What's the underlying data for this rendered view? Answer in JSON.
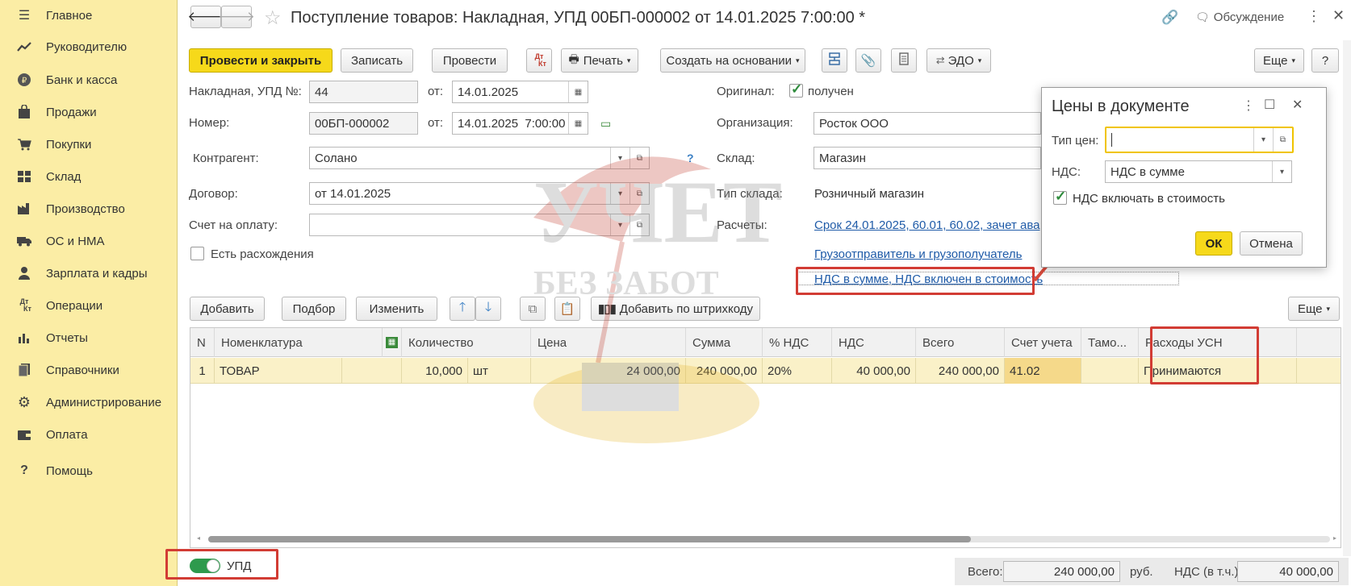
{
  "sidebar": {
    "items": [
      {
        "label": "Главное",
        "icon": "menu-icon"
      },
      {
        "label": "Руководителю",
        "icon": "trend-icon"
      },
      {
        "label": "Банк и касса",
        "icon": "coin-icon"
      },
      {
        "label": "Продажи",
        "icon": "bag-icon"
      },
      {
        "label": "Покупки",
        "icon": "cart-icon"
      },
      {
        "label": "Склад",
        "icon": "warehouse-icon"
      },
      {
        "label": "Производство",
        "icon": "factory-icon"
      },
      {
        "label": "ОС и НМА",
        "icon": "truck-icon"
      },
      {
        "label": "Зарплата и кадры",
        "icon": "person-icon"
      },
      {
        "label": "Операции",
        "icon": "dt-kt-icon"
      },
      {
        "label": "Отчеты",
        "icon": "bar-chart-icon"
      },
      {
        "label": "Справочники",
        "icon": "book-icon"
      },
      {
        "label": "Администрирование",
        "icon": "gear-icon"
      },
      {
        "label": "Оплата",
        "icon": "wallet-icon"
      },
      {
        "label": "Помощь",
        "icon": "question-icon"
      }
    ]
  },
  "header": {
    "title": "Поступление товаров: Накладная, УПД 00БП-000002 от 14.01.2025 7:00:00 *",
    "discussion": "Обсуждение"
  },
  "toolbar": {
    "post_close": "Провести и закрыть",
    "save": "Записать",
    "post": "Провести",
    "dtkt_top": "Дт",
    "dtkt_bottom": "Кт",
    "print": "Печать",
    "create_based": "Создать на основании",
    "edo": "ЭДО",
    "more": "Еще",
    "help": "?"
  },
  "form": {
    "invoice_label": "Накладная, УПД №:",
    "invoice_value": "44",
    "from_label": "от:",
    "invoice_date": "14.01.2025",
    "number_label": "Номер:",
    "number_value": "00БП-000002",
    "number_datetime": "14.01.2025  7:00:00",
    "contractor_label": "Контрагент:",
    "contractor_value": "Солано",
    "contract_label": "Договор:",
    "contract_value": "от 14.01.2025",
    "payment_invoice_label": "Счет на оплату:",
    "payment_invoice_value": "",
    "discrepancy_label": "Есть расхождения",
    "original_label": "Оригинал:",
    "original_value": "получен",
    "org_label": "Организация:",
    "org_value": "Росток ООО",
    "warehouse_label": "Склад:",
    "warehouse_value": "Магазин",
    "warehouse_type_label": "Тип склада:",
    "warehouse_type_value": "Розничный магазин",
    "settlements_label": "Расчеты:",
    "settlements_link": "Срок 24.01.2025, 60.01, 60.02, зачет ава",
    "shipper_link": "Грузоотправитель и грузополучатель",
    "vat_link": "НДС в сумме, НДС включен в стоимость",
    "help_q": "?"
  },
  "table_toolbar": {
    "add": "Добавить",
    "pick": "Подбор",
    "change": "Изменить",
    "barcode": "Добавить по штрихкоду",
    "more": "Еще"
  },
  "table": {
    "headers": [
      "N",
      "Номенклатура",
      "Количество",
      "Цена",
      "Сумма",
      "% НДС",
      "НДС",
      "Всего",
      "Счет учета",
      "Тамо...",
      "Расходы УСН"
    ],
    "row": {
      "n": "1",
      "item": "ТОВАР",
      "qty": "10,000",
      "unit": "шт",
      "price": "24 000,00",
      "sum": "240 000,00",
      "vat_rate": "20%",
      "vat": "40 000,00",
      "total": "240 000,00",
      "account": "41.02",
      "customs": "",
      "usn": "Принимаются"
    }
  },
  "footer": {
    "upd_toggle": "УПД",
    "total_label": "Всего:",
    "total_value": "240 000,00",
    "currency": "руб.",
    "vat_label": "НДС (в т.ч.):",
    "vat_value": "40 000,00"
  },
  "dialog": {
    "title": "Цены в документе",
    "price_type_label": "Тип цен:",
    "price_type_value": "",
    "vat_label": "НДС:",
    "vat_value": "НДС в сумме",
    "include_vat_label": "НДС включать в стоимость",
    "ok": "ОК",
    "cancel": "Отмена"
  },
  "watermark": {
    "line1": "УЧЕТ",
    "line2": "БЕЗ ЗАБОТ"
  },
  "colors": {
    "sidebar_bg": "#fbeda5",
    "primary_button": "#f6d91a",
    "highlight_red": "#d23c34",
    "link": "#1f5ba8",
    "selected_row": "#faf1c8"
  }
}
